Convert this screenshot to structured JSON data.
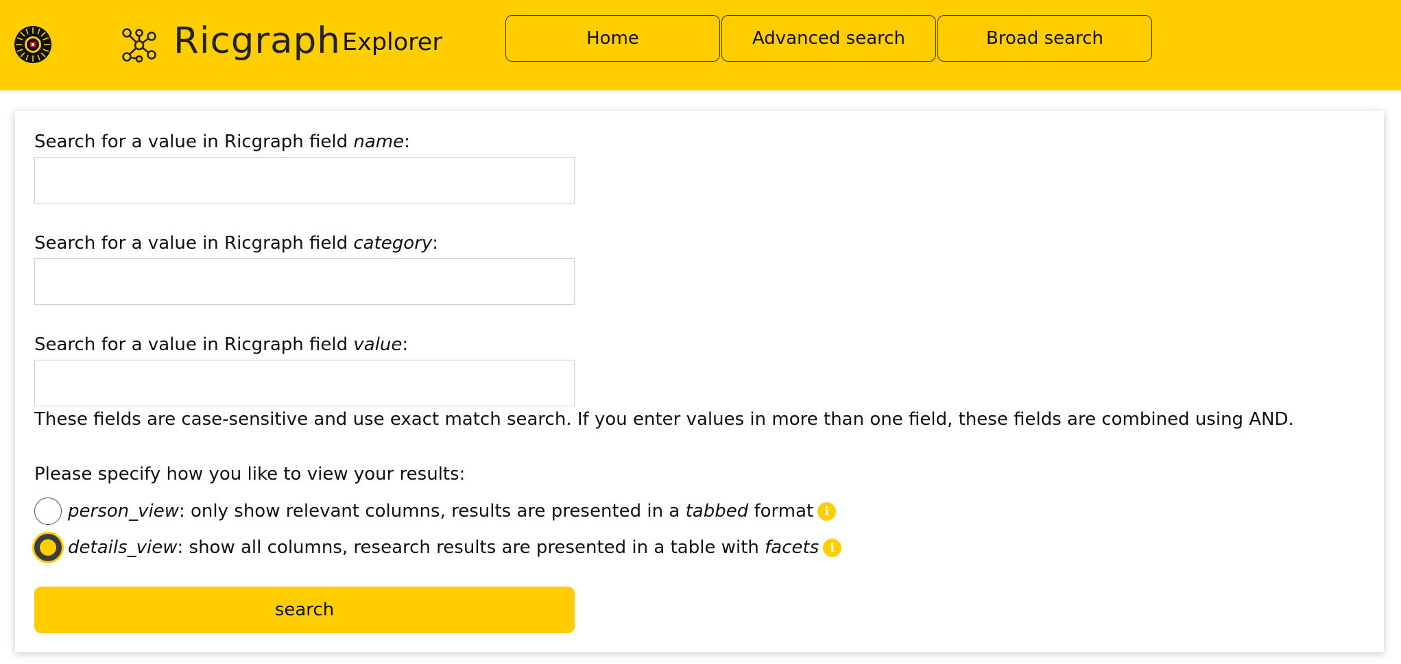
{
  "colors": {
    "brand_yellow": "#ffcd00",
    "text": "#111111",
    "input_border": "#cfcfcf"
  },
  "header": {
    "logo_icon": "university-sun-logo",
    "ricgraph_icon": "graph-network-icon",
    "brand_name": "Ricgraph",
    "brand_sub": "Explorer",
    "nav": [
      {
        "label": "Home"
      },
      {
        "label": "Advanced search"
      },
      {
        "label": "Broad search"
      }
    ]
  },
  "form": {
    "fields": [
      {
        "prefix": "Search for a value in Ricgraph field ",
        "field": "name",
        "suffix": ":",
        "value": ""
      },
      {
        "prefix": "Search for a value in Ricgraph field ",
        "field": "category",
        "suffix": ":",
        "value": ""
      },
      {
        "prefix": "Search for a value in Ricgraph field ",
        "field": "value",
        "suffix": ":",
        "value": ""
      }
    ],
    "note": "These fields are case-sensitive and use exact match search. If you enter values in more than one field, these fields are combined using AND.",
    "view_label": "Please specify how you like to view your results:",
    "views": [
      {
        "name": "person_view",
        "text_a": ": only show relevant columns, results are presented in a ",
        "emph": "tabbed",
        "text_b": " format",
        "checked": false,
        "icon": "info-icon"
      },
      {
        "name": "details_view",
        "text_a": ": show all columns, research results are presented in a table with ",
        "emph": "facets",
        "text_b": "",
        "checked": true,
        "icon": "info-icon"
      }
    ],
    "search_label": "search"
  }
}
